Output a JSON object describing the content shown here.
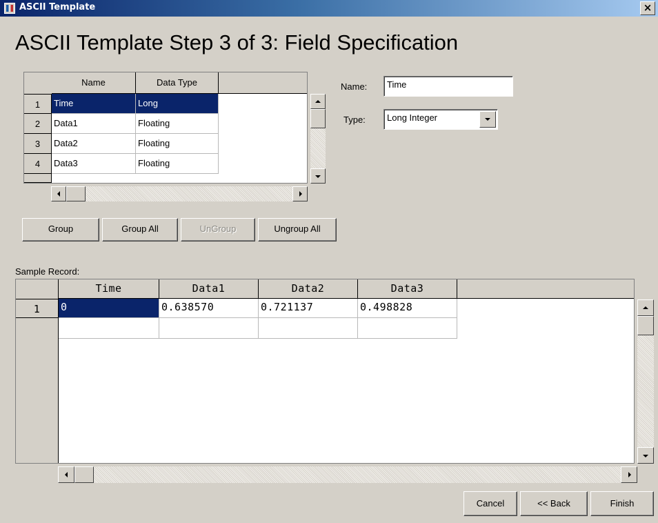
{
  "window": {
    "title": "ASCII Template",
    "close_glyph": "×"
  },
  "heading": "ASCII Template Step 3 of 3:  Field Specification",
  "fields_grid": {
    "headers": [
      "Name",
      "Data Type"
    ],
    "row_numbers": [
      "1",
      "2",
      "3",
      "4"
    ],
    "rows": [
      [
        "Time",
        "Long"
      ],
      [
        "Data1",
        "Floating"
      ],
      [
        "Data2",
        "Floating"
      ],
      [
        "Data3",
        "Floating"
      ]
    ],
    "selected_row": 0
  },
  "properties": {
    "name_label": "Name:",
    "name_value": "Time",
    "type_label": "Type:",
    "type_value": "Long Integer"
  },
  "group_buttons": {
    "group": "Group",
    "group_all": "Group All",
    "ungroup": "UnGroup",
    "ungroup_all": "Ungroup All"
  },
  "sample": {
    "label": "Sample Record:",
    "headers": [
      "Time",
      "Data1",
      "Data2",
      "Data3"
    ],
    "row_numbers": [
      "1"
    ],
    "rows": [
      [
        "0",
        "0.638570",
        "0.721137",
        "0.498828"
      ]
    ]
  },
  "footer": {
    "cancel": "Cancel",
    "back": "<< Back",
    "finish": "Finish"
  },
  "colors": {
    "face": "#d4d0c8",
    "selection": "#0a246a",
    "titlebar": "#0a246a"
  },
  "icons": {
    "app": "grid-app-icon",
    "close": "close-icon",
    "dropdown": "chevron-down-icon"
  }
}
